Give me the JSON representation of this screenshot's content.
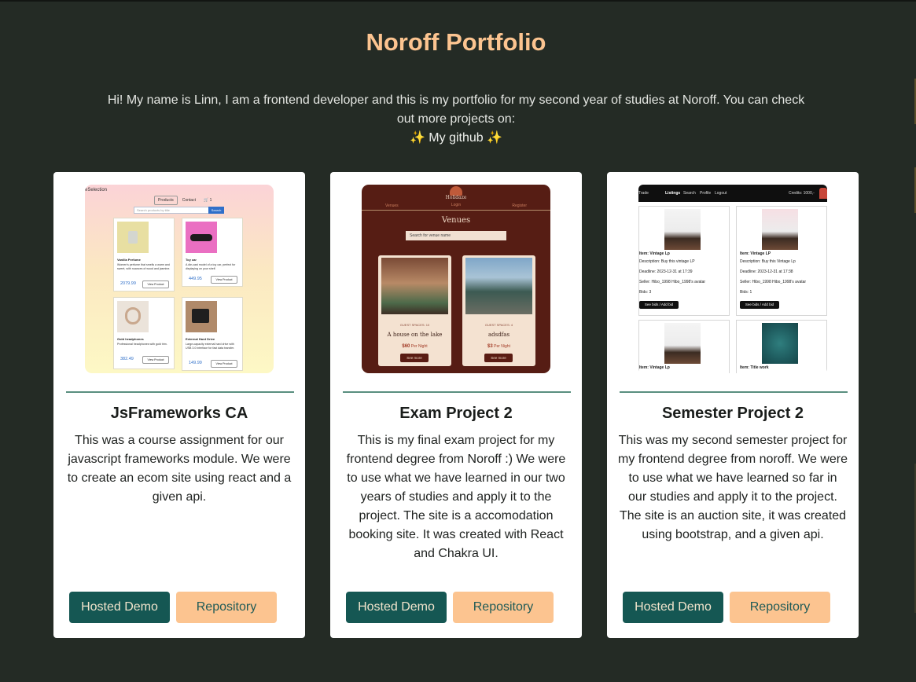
{
  "header": {
    "title": "Noroff Portfolio",
    "intro": "Hi! My name is Linn, I am a frontend developer and this is my portfolio for my second year of studies at Noroff. You can check out more projects on:",
    "github_link": "✨ My github ✨"
  },
  "colors": {
    "background": "#242b25",
    "title": "#fcc490",
    "demo_button": "#155753",
    "repo_button": "#fcc490",
    "divider": "#5a8f7f"
  },
  "projects": [
    {
      "title": "JsFrameworks CA",
      "description": "This was a course assignment for our javascript frameworks module. We were to create an ecom site using react and a given api.",
      "demo_label": "Hosted Demo",
      "repo_label": "Repository",
      "thumbnail": {
        "brand": "eSelection",
        "nav": [
          "Products",
          "Contact",
          "🛒 1"
        ],
        "search_placeholder": "Search products by title",
        "search_button": "Search",
        "products": [
          {
            "title": "Vanilla Perfume",
            "desc": "Women's perfume that smells a warm and sweet, with nuances of wood and jasmine.",
            "price": "2079.99",
            "button": "View Product"
          },
          {
            "title": "Toy car",
            "desc": "A die-cast model of a toy car, perfect for displaying on your shelf.",
            "price": "449.95",
            "button": "View Product"
          },
          {
            "title": "Gold headphones",
            "desc": "Professional headphones with gold trim.",
            "price": "382.49",
            "button": "View Product"
          },
          {
            "title": "External Hard Drive",
            "desc": "Large-capacity external hard drive with USB 3.0 interface for fast data transfer.",
            "price": "149.99",
            "button": "View Product"
          }
        ]
      }
    },
    {
      "title": "Exam Project 2",
      "description": "This is my final exam project for my frontend degree from Noroff :) We were to use what we have learned in our two years of studies and apply it to the project. The site is a accomodation booking site. It was created with React and Chakra UI.",
      "demo_label": "Hosted Demo",
      "repo_label": "Repository",
      "thumbnail": {
        "logo": "Holidaze",
        "nav_left": "Venues",
        "nav_center": "Login",
        "nav_right": "Register",
        "heading": "Venues",
        "search_placeholder": "Search for venue name",
        "venues": [
          {
            "guests": "GUEST SPACES: 10",
            "name": "A house on the lake",
            "price": "$60",
            "per": "Per Night",
            "button": "See more"
          },
          {
            "guests": "GUEST SPACES: 4",
            "name": "adsdfas",
            "price": "$3",
            "per": "Per Night",
            "button": "See more"
          }
        ]
      }
    },
    {
      "title": "Semester Project 2",
      "description": "This was my second semester project for my frontend degree from noroff. We were to use what we have learned so far in our studies and apply it to the project. The site is an auction site, it was created using bootstrap, and a given api.",
      "demo_label": "Hosted Demo",
      "repo_label": "Repository",
      "thumbnail": {
        "brand": "Trade",
        "nav": [
          "Listings",
          "Search",
          "Profile",
          "Logout"
        ],
        "credits": "Credits: 1000,-",
        "listings": [
          {
            "item": "Item: Vintage Lp",
            "desc": "Description: Buy this vintage LP",
            "deadline": "Deadline: 2023-12-31 at 17:39",
            "seller": "Seller: Hibo_1998 Hibo_1998's avatar",
            "bids": "Bids: 3",
            "button": "See bids / Add bid"
          },
          {
            "item": "Item: Vintage LP",
            "desc": "Description: Buy this Vintage Lp",
            "deadline": "Deadline: 2023-12-31 at 17:38",
            "seller": "Seller: Hibo_1998 Hibo_1998's avatar",
            "bids": "Bids: 1",
            "button": "See bids / Add bid"
          },
          {
            "item": "Item: Vintage Lp"
          },
          {
            "item": "Item: Title work"
          }
        ]
      }
    }
  ]
}
